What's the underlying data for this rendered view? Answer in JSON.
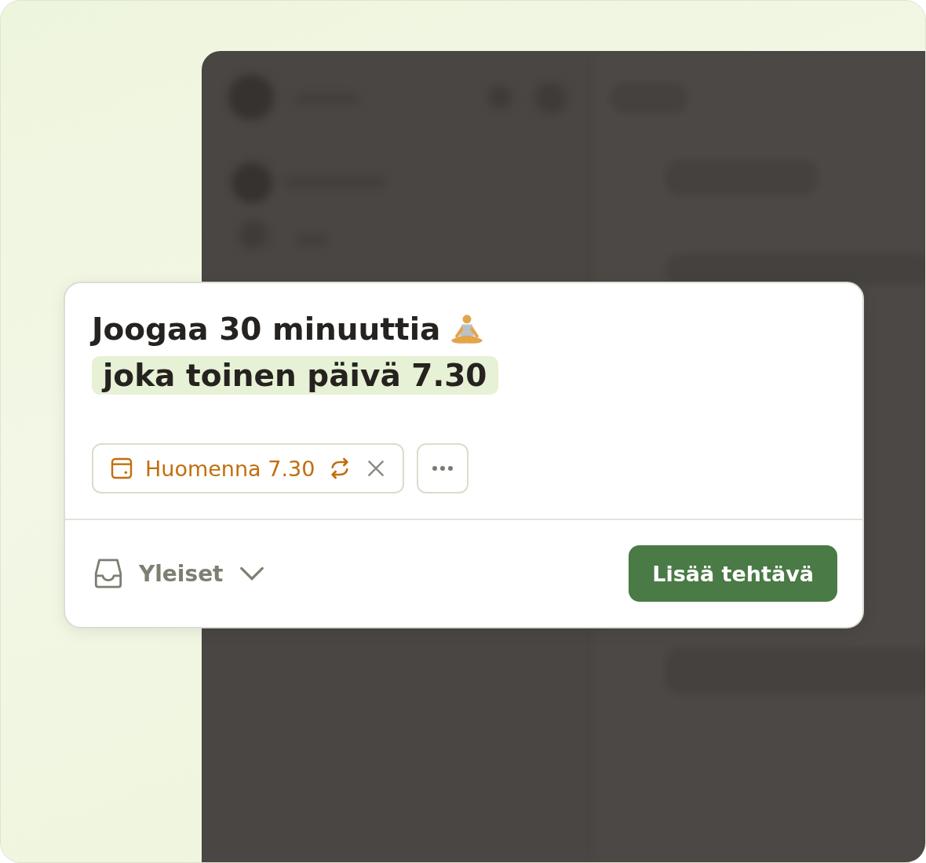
{
  "task": {
    "title": "Joogaa 30 minuuttia",
    "highlight": "joka toinen päivä 7.30"
  },
  "date_chip": {
    "label": "Huomenna 7.30",
    "recurring": true
  },
  "project": {
    "label": "Yleiset"
  },
  "submit": {
    "label": "Lisää tehtävä"
  }
}
